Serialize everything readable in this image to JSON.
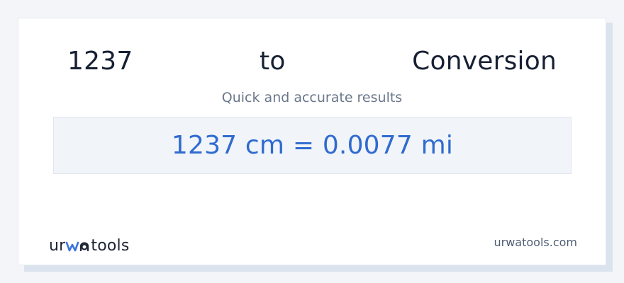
{
  "conversion": {
    "title_parts": [
      "1237",
      "to",
      "Conversion"
    ],
    "subtitle": "Quick and accurate results",
    "result": "1237 cm = 0.0077 mi"
  },
  "footer": {
    "brand": {
      "left": "ur",
      "middle": "wa",
      "right": "tools"
    },
    "site": "urwatools.com"
  },
  "colors": {
    "background": "#f3f5f8",
    "card": "#ffffff",
    "title": "#172033",
    "subtitle": "#6b778a",
    "result": "#2f6bd0",
    "result_box": "#f1f4f8",
    "brand_accent": "#3b74dd"
  }
}
